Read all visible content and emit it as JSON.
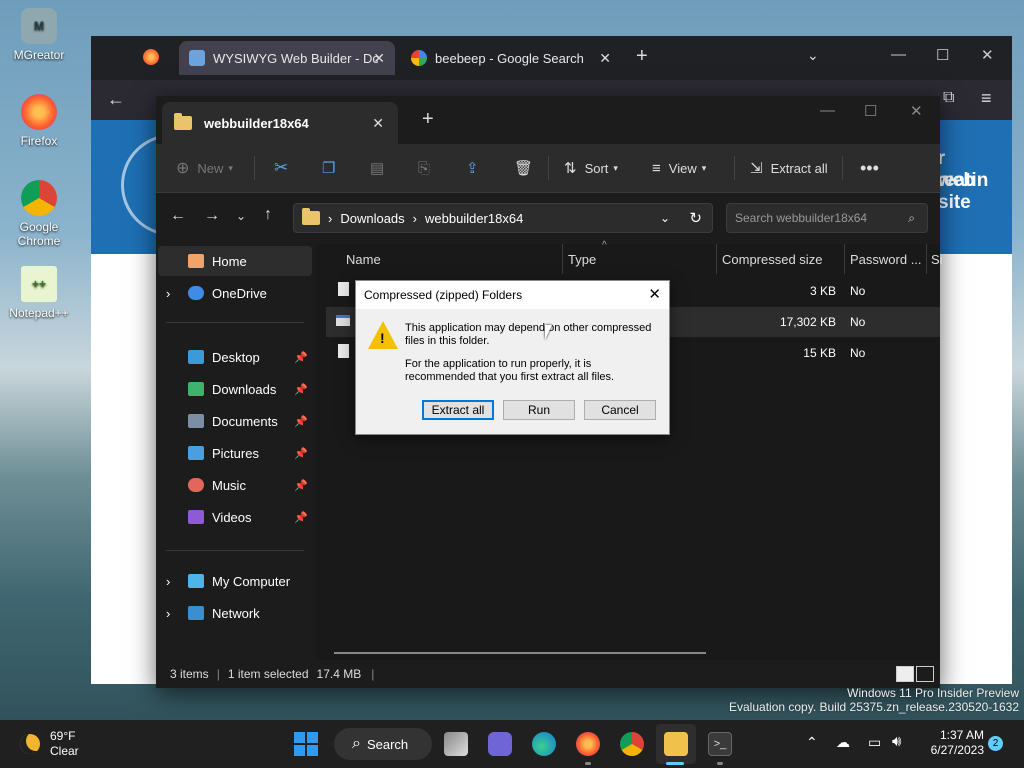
{
  "desktop": {
    "icons": [
      {
        "label": "MGreator"
      },
      {
        "label": "Firefox"
      },
      {
        "label": "Google Chrome"
      },
      {
        "label": "Notepad++"
      }
    ]
  },
  "browser": {
    "tabs": [
      {
        "title": "WYSIWYG Web Builder - Down"
      },
      {
        "title": "beebeep - Google Search"
      }
    ],
    "banner_text_1": "or creatin",
    "banner_text_2": "web site"
  },
  "explorer": {
    "tab_title": "webbuilder18x64",
    "toolbar": {
      "new_label": "New",
      "sort_label": "Sort",
      "view_label": "View",
      "extract_all_label": "Extract all"
    },
    "breadcrumb": [
      "Downloads",
      "webbuilder18x64"
    ],
    "search_placeholder": "Search webbuilder18x64",
    "nav": {
      "home": "Home",
      "onedrive": "OneDrive",
      "desktop": "Desktop",
      "downloads": "Downloads",
      "documents": "Documents",
      "pictures": "Pictures",
      "music": "Music",
      "videos": "Videos",
      "my_computer": "My Computer",
      "network": "Network"
    },
    "columns": {
      "name": "Name",
      "type": "Type",
      "compressed_size": "Compressed size",
      "password": "Password ...",
      "size": "Si"
    },
    "rows": [
      {
        "size": "3 KB",
        "password": "No"
      },
      {
        "size": "17,302 KB",
        "password": "No"
      },
      {
        "size": "15 KB",
        "password": "No"
      }
    ],
    "status": {
      "items": "3 items",
      "selected": "1 item selected",
      "size": "17.4 MB"
    }
  },
  "dialog": {
    "title": "Compressed (zipped) Folders",
    "message1": "This application may depend on other compressed files in this folder.",
    "message2": "For the application to run properly, it is recommended that you first extract all files.",
    "extract_all": "Extract all",
    "run": "Run",
    "cancel": "Cancel"
  },
  "watermark": {
    "line1": "Windows 11 Pro Insider Preview",
    "line2": "Evaluation copy. Build 25375.zn_release.230520-1632"
  },
  "taskbar": {
    "weather_temp": "69°F",
    "weather_desc": "Clear",
    "search_label": "Search",
    "time": "1:37 AM",
    "date": "6/27/2023",
    "notification_count": "2"
  }
}
